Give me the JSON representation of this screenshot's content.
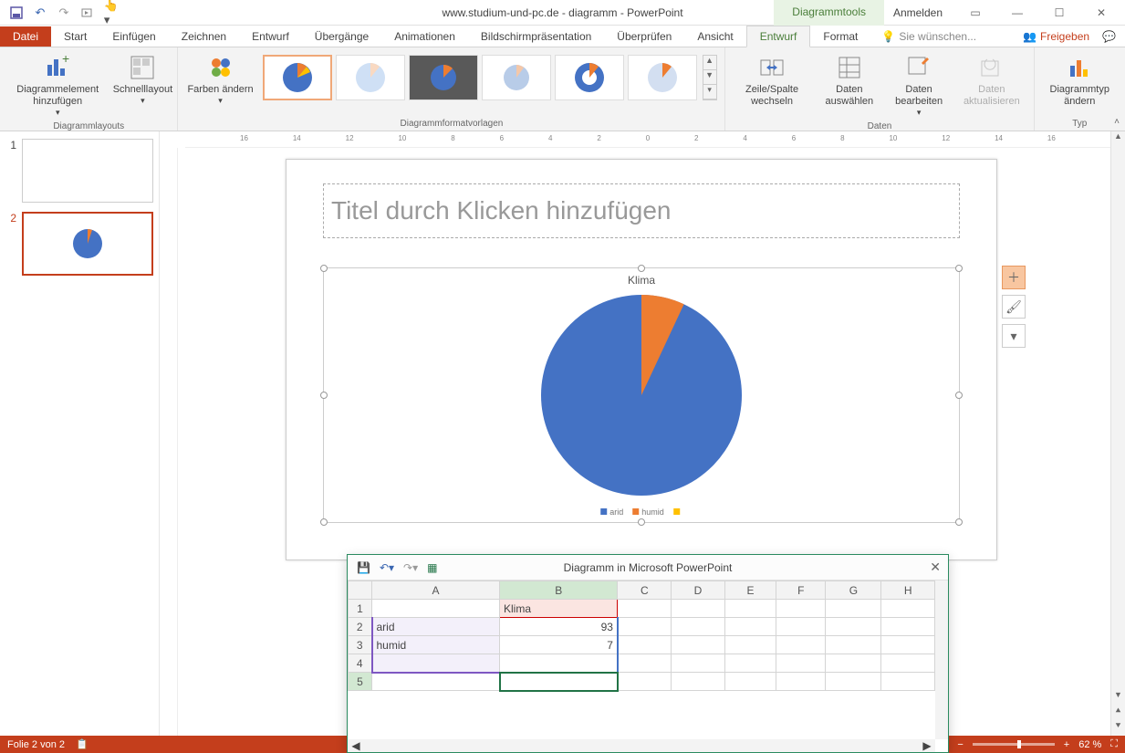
{
  "app_title": "www.studium-und-pc.de - diagramm - PowerPoint",
  "chart_tools_label": "Diagrammtools",
  "signin": "Anmelden",
  "tabs": {
    "file": "Datei",
    "start": "Start",
    "insert": "Einfügen",
    "draw": "Zeichnen",
    "design": "Entwurf",
    "transitions": "Übergänge",
    "animations": "Animationen",
    "slideshow": "Bildschirmpräsentation",
    "review": "Überprüfen",
    "view": "Ansicht",
    "chart_design": "Entwurf",
    "chart_format": "Format"
  },
  "tell_me": "Sie wünschen...",
  "share": "Freigeben",
  "ribbon": {
    "layouts": {
      "add_element": "Diagrammelement hinzufügen",
      "quick_layout": "Schnelllayout",
      "group": "Diagrammlayouts"
    },
    "colors": "Farben ändern",
    "styles_group": "Diagrammformatvorlagen",
    "data": {
      "switch": "Zeile/Spalte wechseln",
      "select": "Daten auswählen",
      "edit": "Daten bearbeiten",
      "refresh": "Daten aktualisieren",
      "group": "Daten"
    },
    "type": {
      "change": "Diagrammtyp ändern",
      "group": "Typ"
    }
  },
  "thumbs": {
    "n1": "1",
    "n2": "2"
  },
  "slide": {
    "title_ph": "Titel durch Klicken hinzufügen",
    "chart_title": "Klima",
    "legend": {
      "a": "arid",
      "b": "humid"
    }
  },
  "chart_data": {
    "type": "pie",
    "title": "Klima",
    "categories": [
      "arid",
      "humid",
      ""
    ],
    "values": [
      93,
      7,
      null
    ],
    "colors": [
      "#4472c4",
      "#ed7d31",
      "#ffc000"
    ]
  },
  "datasheet": {
    "title": "Diagramm in Microsoft PowerPoint",
    "cols": [
      "A",
      "B",
      "C",
      "D",
      "E",
      "F",
      "G",
      "H"
    ],
    "rows": {
      "r1": {
        "n": "1",
        "A": "",
        "B": "Klima"
      },
      "r2": {
        "n": "2",
        "A": "arid",
        "B": "93"
      },
      "r3": {
        "n": "3",
        "A": "humid",
        "B": "7"
      },
      "r4": {
        "n": "4"
      },
      "r5": {
        "n": "5"
      }
    }
  },
  "status": {
    "slide": "Folie 2 von 2",
    "zoom": "62 %"
  },
  "ruler_marks": [
    "16",
    "14",
    "12",
    "10",
    "8",
    "6",
    "4",
    "2",
    "0",
    "2",
    "4",
    "6",
    "8",
    "10",
    "12",
    "14",
    "16"
  ]
}
